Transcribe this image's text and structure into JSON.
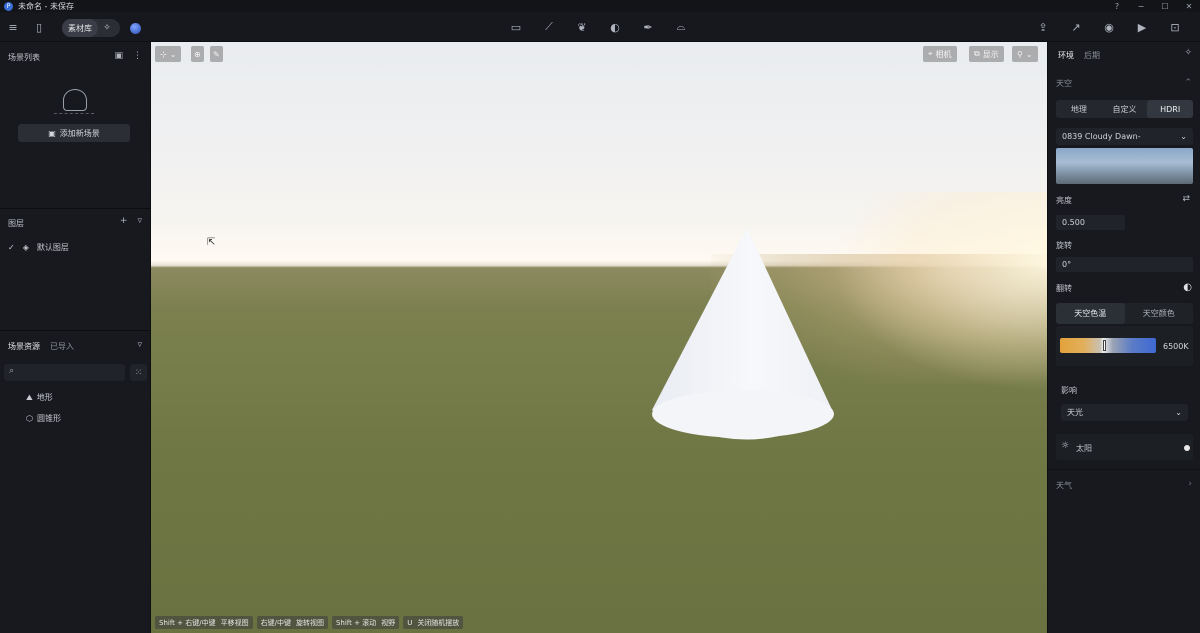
{
  "window": {
    "title": "未命名 - 未保存",
    "controls": [
      "help-icon",
      "minimize-icon",
      "maximize-icon",
      "close-icon"
    ]
  },
  "toolbar": {
    "library_label": "素材库",
    "center_tools": [
      "rect-tool-icon",
      "path-tool-icon",
      "leaf-tool-icon",
      "fire-tool-icon",
      "pen-tool-icon",
      "hat-tool-icon"
    ],
    "right_tools": [
      "export-icon",
      "share-icon",
      "camera-icon",
      "video-icon",
      "inbox-icon"
    ]
  },
  "left": {
    "scene_list_title": "场景列表",
    "add_scene_label": "添加新场景",
    "layers_title": "图层",
    "default_layer_label": "默认图层",
    "assets_tab": "场景资源",
    "imported_tab": "已导入",
    "search_placeholder": "",
    "asset_items": [
      "地形",
      "圆锥形"
    ]
  },
  "viewport": {
    "camera_label": "相机",
    "display_label": "显示",
    "hints": [
      {
        "key": "Shift + 右键/中键",
        "action": "平移视图"
      },
      {
        "key": "右键/中键",
        "action": "旋转视图"
      },
      {
        "key": "Shift + 滚动",
        "action": "视野"
      },
      {
        "key": "U",
        "action": "关闭随机摆放"
      }
    ]
  },
  "right": {
    "tab_environment": "环境",
    "tab_post": "后期",
    "sky_title": "天空",
    "sky_modes": [
      "地理",
      "自定义",
      "HDRI"
    ],
    "sky_mode_selected": "HDRI",
    "hdri_name": "0839 Cloudy Dawn-",
    "brightness_label": "亮度",
    "brightness_value": "0.500",
    "rotation_label": "旋转",
    "rotation_value": "0°",
    "flip_label": "翻转",
    "color_tabs": [
      "天空色温",
      "天空颜色"
    ],
    "color_tab_selected": "天空色温",
    "temperature_value": "6500K",
    "temperature_level": 0.46,
    "influence_label": "影响",
    "influence_value": "天光",
    "sun_label": "太阳",
    "weather_title": "天气"
  },
  "colors": {
    "accent_blue": "#3f69d4",
    "panel_bg": "#17191e",
    "warm_orange": "#e3a23b"
  }
}
